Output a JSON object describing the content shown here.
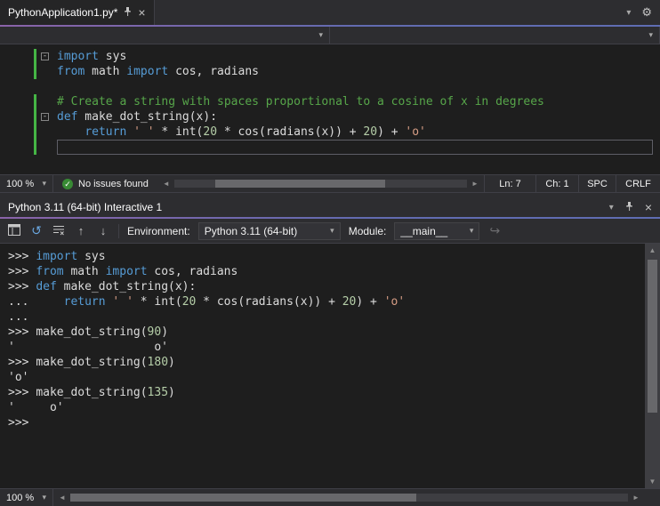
{
  "colors": {
    "accent_purple": "#8a63a9",
    "accent_blue": "#5f6db3",
    "keyword": "#569cd6",
    "string": "#d69d85",
    "number": "#b5cea8",
    "comment": "#57a64a",
    "plain_text": "#dcdcdc",
    "change_bar_green": "#45b545",
    "check_green": "#388a34",
    "editor_background": "#1e1e1e",
    "chrome_background": "#2d2d30"
  },
  "icons": {
    "close": "×",
    "chevron_down": "▾",
    "gear": "⚙",
    "reset": "↺",
    "history_prev": "↑",
    "history_next": "↓",
    "send": "↪",
    "check": "✓",
    "scroll_up": "▲",
    "scroll_down": "▼",
    "scroll_left": "◄",
    "scroll_right": "►",
    "fold_collapse": "-"
  },
  "tab_bar": {
    "tab_title": "PythonApplication1.py*"
  },
  "editor": {
    "lines": [
      {
        "changed": true,
        "fold": true,
        "current": false,
        "tokens": [
          [
            "import",
            "kw"
          ],
          [
            " sys",
            "pl"
          ]
        ]
      },
      {
        "changed": true,
        "fold": false,
        "current": false,
        "tokens": [
          [
            "from",
            "kw"
          ],
          [
            " math ",
            "pl"
          ],
          [
            "import",
            "kw"
          ],
          [
            " cos, radians",
            "pl"
          ]
        ]
      },
      {
        "changed": false,
        "fold": false,
        "current": false,
        "tokens": []
      },
      {
        "changed": true,
        "fold": false,
        "current": false,
        "tokens": [
          [
            "# Create a string with spaces proportional to a cosine of x in degrees",
            "com"
          ]
        ]
      },
      {
        "changed": true,
        "fold": true,
        "current": false,
        "tokens": [
          [
            "def",
            "kw"
          ],
          [
            " make_dot_string(x):",
            "pl"
          ]
        ]
      },
      {
        "changed": true,
        "fold": false,
        "current": false,
        "tokens": [
          [
            "    ",
            "pl"
          ],
          [
            "return",
            "kw"
          ],
          [
            " ",
            "pl"
          ],
          [
            "' '",
            "str"
          ],
          [
            " * int(",
            "pl"
          ],
          [
            "20",
            "num"
          ],
          [
            " * cos(radians(x)) + ",
            "pl"
          ],
          [
            "20",
            "num"
          ],
          [
            ") + ",
            "pl"
          ],
          [
            "'o'",
            "str"
          ]
        ]
      },
      {
        "changed": true,
        "fold": false,
        "current": true,
        "tokens": []
      }
    ]
  },
  "editor_status": {
    "zoom": "100 %",
    "message": "No issues found",
    "line": "Ln: 7",
    "column": "Ch: 1",
    "spaces": "SPC",
    "line_ending": "CRLF"
  },
  "interactive": {
    "title": "Python 3.11 (64-bit) Interactive 1",
    "toolbar": {
      "environment_label": "Environment:",
      "environment_value": "Python 3.11 (64-bit)",
      "module_label": "Module:",
      "module_value": "__main__"
    },
    "zoom": "100 %",
    "lines": [
      [
        [
          ">>> ",
          "pr"
        ],
        [
          "import",
          "kw"
        ],
        [
          " sys",
          "pl"
        ]
      ],
      [
        [
          ">>> ",
          "pr"
        ],
        [
          "from",
          "kw"
        ],
        [
          " math ",
          "pl"
        ],
        [
          "import",
          "kw"
        ],
        [
          " cos, radians",
          "pl"
        ]
      ],
      [
        [
          ">>> ",
          "pr"
        ],
        [
          "def",
          "kw"
        ],
        [
          " make_dot_string(x):",
          "pl"
        ]
      ],
      [
        [
          "... ",
          "pr"
        ],
        [
          "    ",
          "pl"
        ],
        [
          "return",
          "kw"
        ],
        [
          " ",
          "pl"
        ],
        [
          "' '",
          "str"
        ],
        [
          " * int(",
          "pl"
        ],
        [
          "20",
          "num"
        ],
        [
          " * cos(radians(x)) + ",
          "pl"
        ],
        [
          "20",
          "num"
        ],
        [
          ") + ",
          "pl"
        ],
        [
          "'o'",
          "str"
        ]
      ],
      [
        [
          "...",
          "pr"
        ]
      ],
      [
        [
          ">>> ",
          "pr"
        ],
        [
          "make_dot_string(",
          "pl"
        ],
        [
          "90",
          "num"
        ],
        [
          ")",
          "pl"
        ]
      ],
      [
        [
          "'                    o'",
          "pl"
        ]
      ],
      [
        [
          ">>> ",
          "pr"
        ],
        [
          "make_dot_string(",
          "pl"
        ],
        [
          "180",
          "num"
        ],
        [
          ")",
          "pl"
        ]
      ],
      [
        [
          "'o'",
          "pl"
        ]
      ],
      [
        [
          ">>> ",
          "pr"
        ],
        [
          "make_dot_string(",
          "pl"
        ],
        [
          "135",
          "num"
        ],
        [
          ")",
          "pl"
        ]
      ],
      [
        [
          "'     o'",
          "pl"
        ]
      ],
      [
        [
          ">>> ",
          "pr"
        ]
      ]
    ]
  }
}
